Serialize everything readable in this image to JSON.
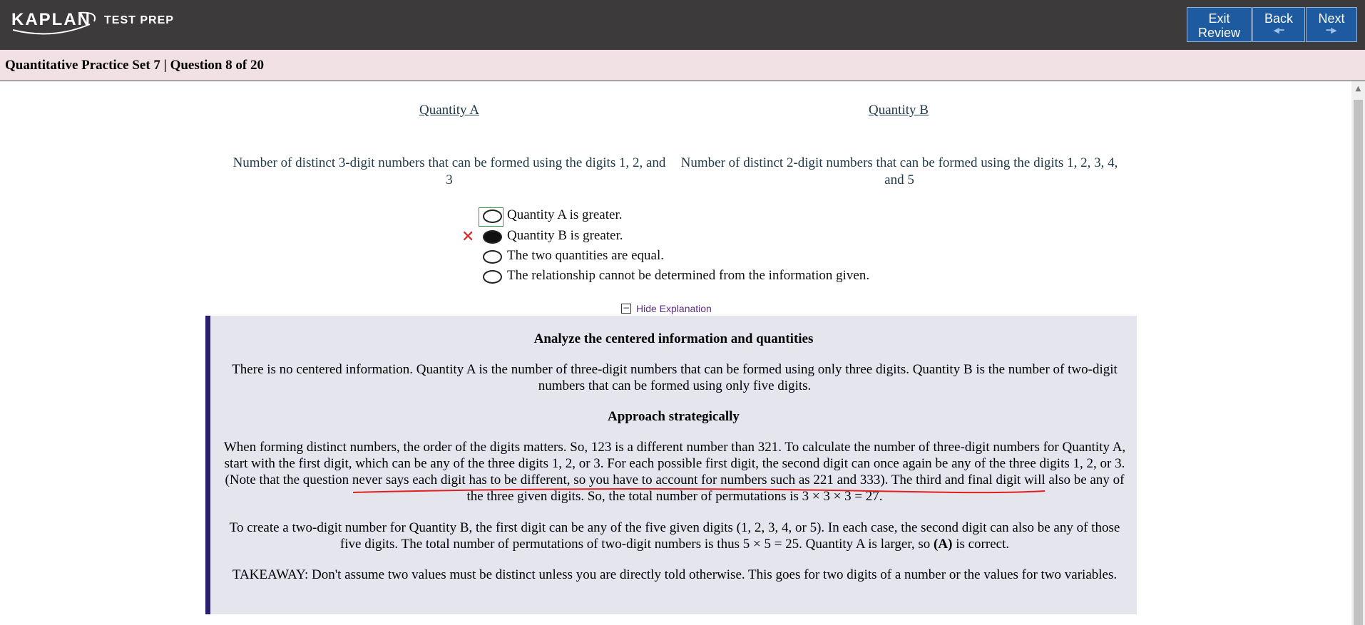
{
  "header": {
    "logo_main": "KAPLAN",
    "logo_sub": "TEST PREP",
    "buttons": {
      "exit_line1": "Exit",
      "exit_line2": "Review",
      "back": "Back",
      "next": "Next"
    }
  },
  "title": "Quantitative Practice Set 7 | Question 8 of 20",
  "question": {
    "quantity_a_heading": "Quantity A",
    "quantity_b_heading": "Quantity B",
    "quantity_a_text": "Number of distinct 3-digit numbers that can be formed using the digits 1, 2, and 3",
    "quantity_b_text": "Number of distinct 2-digit numbers that can be formed using the digits 1, 2, 3, 4, and 5",
    "choices": [
      {
        "label": "Quantity A is greater.",
        "selected": false
      },
      {
        "label": "Quantity B is greater.",
        "selected": true
      },
      {
        "label": "The two quantities are equal.",
        "selected": false
      },
      {
        "label": "The relationship cannot be determined from the information given.",
        "selected": false
      }
    ],
    "selected_index": 1,
    "correct_index": 0
  },
  "explanation_toggle": {
    "symbol": "−",
    "label": "Hide Explanation"
  },
  "explanation": {
    "heading1": "Analyze the centered information and quantities",
    "para1": "There is no centered information. Quantity A is the number of three-digit numbers that can be formed using only three digits. Quantity B is the number of two-digit numbers that can be formed using only five digits.",
    "heading2": "Approach strategically",
    "para2": "When forming distinct numbers, the order of the digits matters. So, 123 is a different number than 321. To calculate the number of three-digit numbers for Quantity A, start with the first digit, which can be any of the three digits 1, 2, or 3. For each possible first digit, the second digit can once again be any of the three digits 1, 2, or 3. (Note that the question never says each digit has to be different, so you have to account for numbers such as 221 and 333). The third and final digit will also be any of the three given digits. So, the total number of permutations is 3 × 3 × 3 = 27.",
    "para3_before": "To create a two-digit number for Quantity B, the first digit can be any of the five given digits (1, 2, 3, 4, or 5). In each case, the second digit can also be any of those five digits. The total number of permutations of two-digit numbers is thus 5 × 5 = 25. Quantity A is larger, so ",
    "para3_bold": "(A)",
    "para3_after": " is correct.",
    "para4": "TAKEAWAY: Don't assume two values must be distinct unless you are directly told otherwise. This goes for two digits of a number or the values for two variables."
  },
  "colors": {
    "header_bg": "#3c3a3a",
    "button_bg": "#1e5aa0",
    "title_bg": "#f2e1e4",
    "explanation_bg": "#e5e5ee",
    "explanation_border": "#2a1f6e",
    "wrong_mark": "#e02020",
    "annotation_underline": "#e02020"
  },
  "icons": {
    "wrong": "x-mark-icon",
    "toggle": "minus-box-icon",
    "back_arrow": "left-arrow-icon",
    "next_arrow": "right-arrow-icon"
  }
}
